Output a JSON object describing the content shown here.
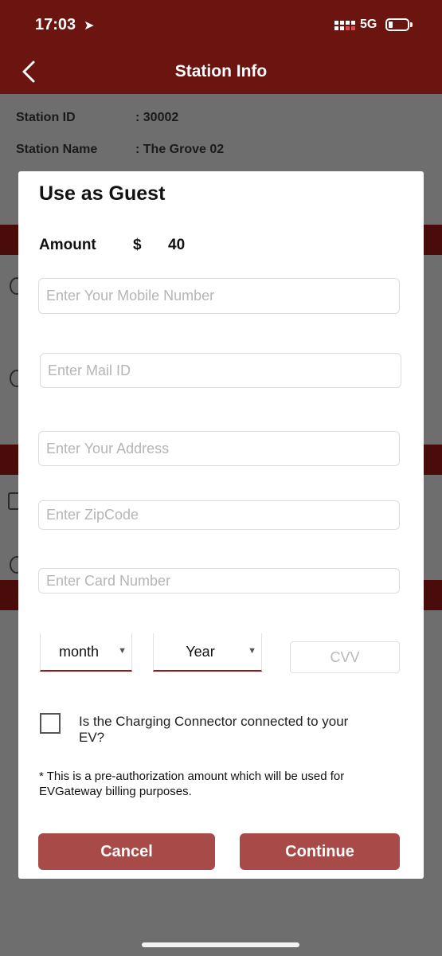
{
  "status_bar": {
    "time": "17:03",
    "network": "5G"
  },
  "nav": {
    "title": "Station Info"
  },
  "background": {
    "station_id_label": "Station ID",
    "station_id_value": ": 30002",
    "station_name_label": "Station Name",
    "station_name_value": ":  The Grove 02"
  },
  "modal": {
    "title": "Use as Guest",
    "amount_label": "Amount",
    "currency": "$",
    "amount_value": "40",
    "fields": {
      "mobile_placeholder": "Enter Your Mobile Number",
      "mail_placeholder": "Enter Mail ID",
      "address_placeholder": "Enter Your Address",
      "zip_placeholder": "Enter ZipCode",
      "card_placeholder": "Enter Card Number",
      "cvv_placeholder": "CVV"
    },
    "month_label": "month",
    "year_label": "Year",
    "connector_question": "Is the Charging Connector connected to your EV?",
    "note": "* This is a pre-authorization amount which will be used for EVGateway billing purposes.",
    "cancel_label": "Cancel",
    "continue_label": "Continue"
  },
  "colors": {
    "header": "#6b1410",
    "button": "#a84a47",
    "dropdown_underline": "#8b1e1b"
  }
}
